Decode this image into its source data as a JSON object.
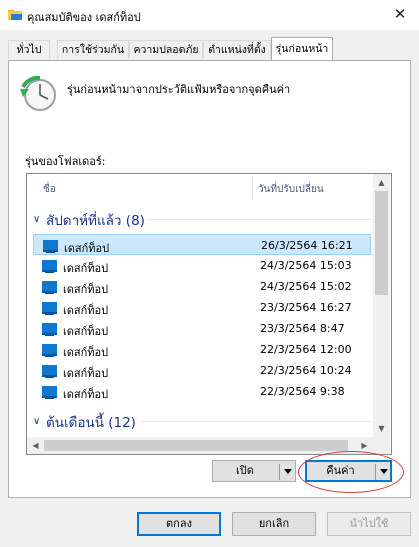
{
  "window": {
    "title": "คุณสมบัติของ เดสก์ท็อป",
    "close_glyph": "✕"
  },
  "tabs": [
    {
      "label": "ทั่วไป",
      "active": false
    },
    {
      "label": "การใช้ร่วมกัน",
      "active": false
    },
    {
      "label": "ความปลอดภัย",
      "active": false
    },
    {
      "label": "ตำแหน่งที่ตั้ง",
      "active": false
    },
    {
      "label": "รุ่นก่อนหน้า",
      "active": true
    }
  ],
  "panel": {
    "description": "รุ่นก่อนหน้ามาจากประวัติแฟ้มหรือจากจุดคืนค่า",
    "folder_versions_label": "รุ่นของโฟลเดอร์:"
  },
  "list": {
    "columns": {
      "name": "ชื่อ",
      "date": "วันที่ปรับเปลี่ยน"
    },
    "groups": [
      {
        "label": "สัปดาห์ที่แล้ว (8)",
        "chevron": "∨",
        "rows": [
          {
            "name": "เดสก์ท็อป",
            "date": "26/3/2564 16:21",
            "selected": true
          },
          {
            "name": "เดสก์ท็อป",
            "date": "24/3/2564 15:03",
            "selected": false
          },
          {
            "name": "เดสก์ท็อป",
            "date": "24/3/2564 15:02",
            "selected": false
          },
          {
            "name": "เดสก์ท็อป",
            "date": "23/3/2564 16:27",
            "selected": false
          },
          {
            "name": "เดสก์ท็อป",
            "date": "23/3/2564 8:47",
            "selected": false
          },
          {
            "name": "เดสก์ท็อป",
            "date": "22/3/2564 12:00",
            "selected": false
          },
          {
            "name": "เดสก์ท็อป",
            "date": "22/3/2564 10:24",
            "selected": false
          },
          {
            "name": "เดสก์ท็อป",
            "date": "22/3/2564 9:38",
            "selected": false
          }
        ]
      },
      {
        "label": "ต้นเดือนนี้ (12)",
        "chevron": "∨"
      }
    ],
    "scroll_glyphs": {
      "up": "▲",
      "down": "▼",
      "left": "◀",
      "right": "▶"
    }
  },
  "actions": {
    "open_label": "เปิด",
    "restore_label": "คืนค่า"
  },
  "footer": {
    "ok_label": "ตกลง",
    "cancel_label": "ยกเลิก",
    "apply_label": "นำไปใช้"
  },
  "colors": {
    "accent": "#0078d7",
    "selection": "#cce8ff",
    "group_header": "#1e3287",
    "annotation": "#d93b3b"
  },
  "icons": {
    "window": "folder-icon",
    "restore": "restore-clock-icon",
    "row": "desktop-folder-icon"
  }
}
